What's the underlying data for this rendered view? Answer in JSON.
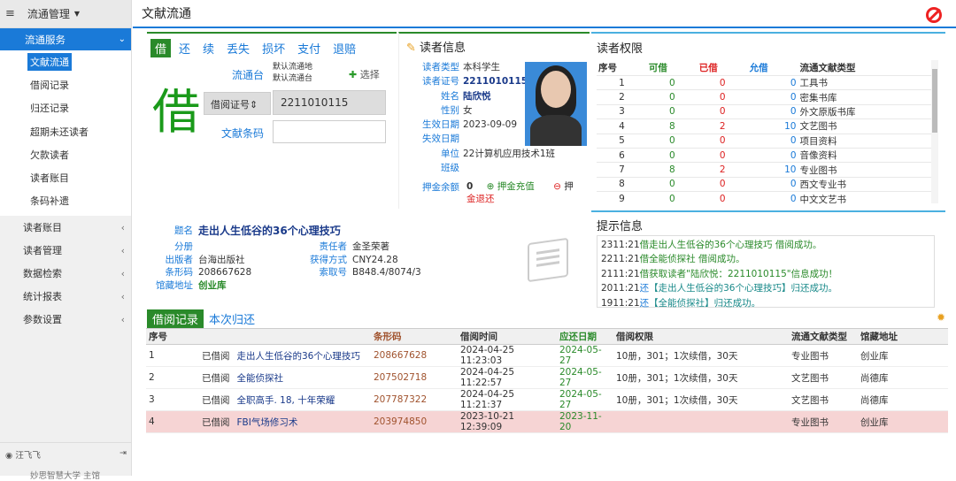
{
  "sidebar": {
    "top_label": "流通管理",
    "active_group": "流通服务",
    "sub_items": [
      "文献流通",
      "借阅记录",
      "归还记录",
      "超期未还读者",
      "欠款读者",
      "读者账目",
      "条码补遗"
    ],
    "groups": [
      "读者账目",
      "读者管理",
      "数据检索",
      "统计报表",
      "参数设置"
    ],
    "user": "汪飞飞",
    "org": "妙思智慧大学 主馆"
  },
  "header": {
    "title": "文献流通"
  },
  "ops": {
    "items": [
      "借",
      "还",
      "续",
      "丢失",
      "损坏",
      "支付",
      "退赔"
    ],
    "big_char": "借"
  },
  "circ": {
    "desk_label": "流通台",
    "desk_value1": "默认流通地",
    "desk_value2": "默认流通台",
    "choose": "选择",
    "card_select": "借阅证号",
    "card_value": "2211010115",
    "barcode_label": "文献条码"
  },
  "reader": {
    "title": "读者信息",
    "fields": [
      {
        "k": "读者类型",
        "v": "本科学生"
      },
      {
        "k": "读者证号",
        "v": "2211010115"
      },
      {
        "k": "姓名",
        "v": "陆欣悦"
      },
      {
        "k": "性别",
        "v": "女"
      },
      {
        "k": "生效日期",
        "v": "2023-09-09"
      },
      {
        "k": "失效日期",
        "v": ""
      },
      {
        "k": "单位",
        "v": "22计算机应用技术1班"
      },
      {
        "k": "班级",
        "v": ""
      }
    ],
    "deposit_label": "押金余额",
    "deposit_value": "0",
    "deposit_charge": "押金充值",
    "deposit_out": "押",
    "deposit_refund": "金退还"
  },
  "perm": {
    "title": "读者权限",
    "headers": [
      "序号",
      "可借",
      "已借",
      "允借",
      "流通文献类型"
    ],
    "rows": [
      [
        "1",
        "0",
        "0",
        "0",
        "工具书"
      ],
      [
        "2",
        "0",
        "0",
        "0",
        "密集书库"
      ],
      [
        "3",
        "0",
        "0",
        "0",
        "外文原版书库"
      ],
      [
        "4",
        "8",
        "2",
        "10",
        "文艺图书"
      ],
      [
        "5",
        "0",
        "0",
        "0",
        "项目资料"
      ],
      [
        "6",
        "0",
        "0",
        "0",
        "音像资料"
      ],
      [
        "7",
        "8",
        "2",
        "10",
        "专业图书"
      ],
      [
        "8",
        "0",
        "0",
        "0",
        "西文专业书"
      ],
      [
        "9",
        "0",
        "0",
        "0",
        "中文文艺书"
      ]
    ]
  },
  "tips": {
    "title": "提示信息",
    "msgs": [
      {
        "time": "2311:21",
        "act": "借",
        "text": "走出人生低谷的36个心理技巧 借阅成功。"
      },
      {
        "time": "2211:21",
        "act": "借",
        "text": "全能侦探社 借阅成功。"
      },
      {
        "time": "2111:21",
        "act": "借",
        "text": "获取读者\"陆欣悦：2211010115\"信息成功！"
      },
      {
        "time": "2011:21",
        "act": "还",
        "text": "【走出人生低谷的36个心理技巧】归还成功。"
      },
      {
        "time": "1911:21",
        "act": "还",
        "text": "【全能侦探社】归还成功。"
      }
    ]
  },
  "book": {
    "k_title": "题名",
    "title": "走出人生低谷的36个心理技巧",
    "k_cat": "分册",
    "cat": "",
    "k_pub": "出版者",
    "pub": "台海出版社",
    "k_bc": "条形码",
    "bc": "208667628",
    "k_loc": "馆藏地址",
    "loc": "创业库",
    "k_author": "责任者",
    "author": "金圣荣著",
    "k_price": "获得方式",
    "price": "CNY24.28",
    "k_call": "索取号",
    "call": "B848.4/8074/3"
  },
  "records": {
    "tabs": [
      "借阅记录",
      "本次归还"
    ],
    "headers": [
      "序号",
      "",
      "条形码",
      "借阅时间",
      "应还日期",
      "借阅权限",
      "流通文献类型",
      "馆藏地址"
    ],
    "rows": [
      {
        "n": "1",
        "st": "已借阅",
        "title": "走出人生低谷的36个心理技巧",
        "bc": "208667628",
        "time": "2024-04-25 11:23:03",
        "due": "2024-05-27",
        "perm": "10册，301；1次续借，30天",
        "type": "专业图书",
        "loc": "创业库"
      },
      {
        "n": "2",
        "st": "已借阅",
        "title": "全能侦探社",
        "bc": "207502718",
        "time": "2024-04-25 11:22:57",
        "due": "2024-05-27",
        "perm": "10册，301；1次续借，30天",
        "type": "文艺图书",
        "loc": "尚德库"
      },
      {
        "n": "3",
        "st": "已借阅",
        "title": "全职高手. 18, 十年荣耀",
        "bc": "207787322",
        "time": "2024-04-25 11:21:37",
        "due": "2024-05-27",
        "perm": "10册，301；1次续借，30天",
        "type": "文艺图书",
        "loc": "尚德库"
      },
      {
        "n": "4",
        "st": "已借阅",
        "title": "FBI气场修习术",
        "bc": "203974850",
        "time": "2023-10-21 12:39:09",
        "due": "2023-11-20",
        "perm": "",
        "type": "专业图书",
        "loc": "创业库"
      }
    ]
  }
}
